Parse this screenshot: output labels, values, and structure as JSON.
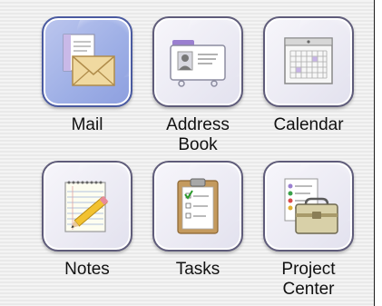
{
  "apps": [
    {
      "id": "mail",
      "label_lines": [
        "Mail"
      ],
      "icon": "mail-icon",
      "selected": true
    },
    {
      "id": "address-book",
      "label_lines": [
        "Address",
        "Book"
      ],
      "icon": "address-book-icon",
      "selected": false
    },
    {
      "id": "calendar",
      "label_lines": [
        "Calendar"
      ],
      "icon": "calendar-icon",
      "selected": false
    },
    {
      "id": "notes",
      "label_lines": [
        "Notes"
      ],
      "icon": "notes-icon",
      "selected": false
    },
    {
      "id": "tasks",
      "label_lines": [
        "Tasks"
      ],
      "icon": "tasks-icon",
      "selected": false
    },
    {
      "id": "project-center",
      "label_lines": [
        "Project",
        "Center"
      ],
      "icon": "project-center-icon",
      "selected": false
    }
  ],
  "colors": {
    "selected_tile": "#9fb0e6",
    "tile_border": "#5f5c7a",
    "panel_border": "#1a1a1a"
  }
}
